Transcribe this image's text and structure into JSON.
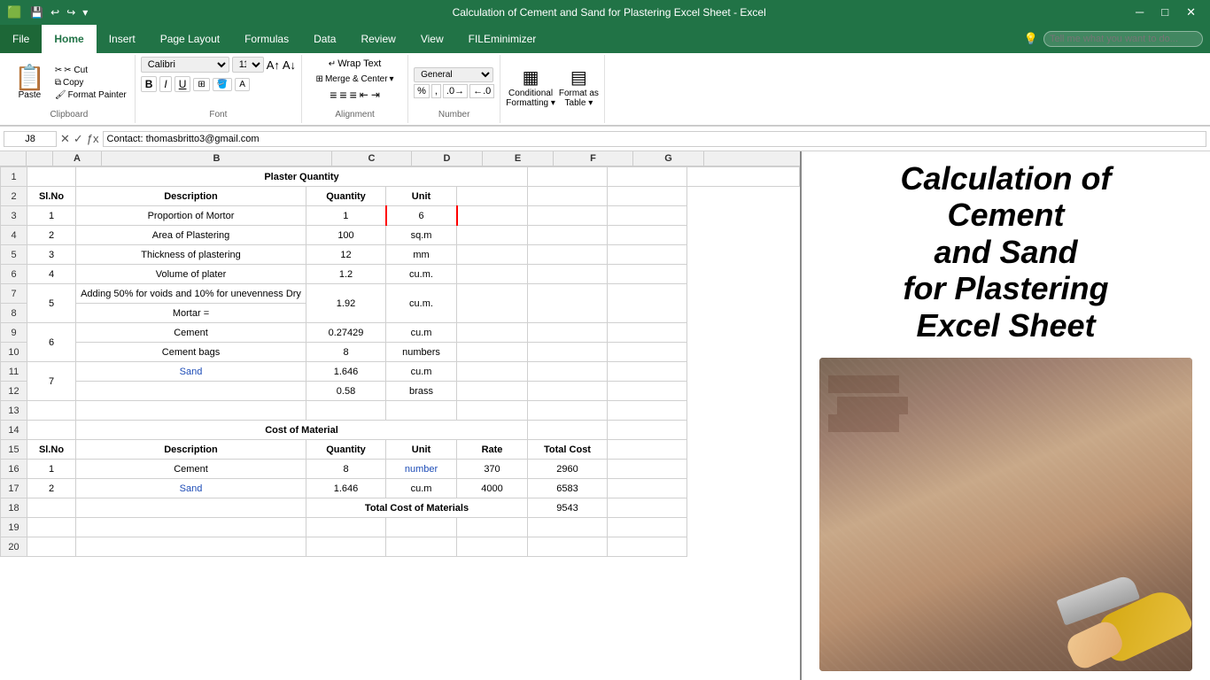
{
  "titleBar": {
    "title": "Calculation of Cement and Sand for Plastering Excel Sheet - Excel",
    "saveIcon": "💾",
    "undoIcon": "↩",
    "redoIcon": "↪"
  },
  "ribbon": {
    "tabs": [
      "File",
      "Home",
      "Insert",
      "Page Layout",
      "Formulas",
      "Data",
      "Review",
      "View",
      "FILEminimizer"
    ],
    "activeTab": "Home",
    "searchPlaceholder": "Tell me what you want to do...",
    "groups": {
      "clipboard": {
        "label": "Clipboard",
        "paste": "Paste",
        "cut": "✂ Cut",
        "copy": "Copy",
        "formatPainter": "Format Painter"
      },
      "font": {
        "label": "Font",
        "fontName": "Calibri",
        "fontSize": "11"
      },
      "alignment": {
        "label": "Alignment",
        "wrapText": "Wrap Text",
        "mergeCenter": "Merge & Center"
      },
      "number": {
        "label": "Number"
      }
    }
  },
  "formulaBar": {
    "cellRef": "J8",
    "formula": "Contact: thomasbritto3@gmail.com"
  },
  "columns": [
    "A",
    "B",
    "C",
    "D",
    "E",
    "F",
    "G"
  ],
  "rows": [
    {
      "num": 1,
      "cells": [
        "",
        "Plaster Quantity",
        "",
        "",
        "",
        "",
        ""
      ],
      "special": "merged-header-row1"
    },
    {
      "num": 2,
      "cells": [
        "Sl.No",
        "Description",
        "Quantity",
        "Unit",
        "",
        "",
        ""
      ],
      "special": "header-row"
    },
    {
      "num": 3,
      "cells": [
        "1",
        "Proportion of Mortor",
        "1",
        "6",
        "",
        "",
        ""
      ],
      "special": "data-row"
    },
    {
      "num": 4,
      "cells": [
        "2",
        "Area of Plastering",
        "100",
        "sq.m",
        "",
        "",
        ""
      ],
      "special": "data-row"
    },
    {
      "num": 5,
      "cells": [
        "3",
        "Thickness of plastering",
        "12",
        "mm",
        "",
        "",
        ""
      ],
      "special": "data-row"
    },
    {
      "num": 6,
      "cells": [
        "4",
        "Volume of plater",
        "1.2",
        "cu.m.",
        "",
        "",
        ""
      ],
      "special": "data-row"
    },
    {
      "num": 7,
      "cells": [
        "5",
        "Adding 50% for voids and 10% for unevenness Dry",
        "1.92",
        "cu.m.",
        "",
        "",
        ""
      ],
      "special": "data-row-merged"
    },
    {
      "num": 8,
      "cells": [
        "",
        "Mortar =",
        "",
        "",
        "",
        "",
        ""
      ],
      "special": "data-row-cont"
    },
    {
      "num": 9,
      "cells": [
        "6",
        "Cement",
        "0.27429",
        "cu.m",
        "",
        "",
        ""
      ],
      "special": "data-row-merged6"
    },
    {
      "num": 10,
      "cells": [
        "",
        "Cement bags",
        "8",
        "numbers",
        "",
        "",
        ""
      ],
      "special": "data-row-cont"
    },
    {
      "num": 11,
      "cells": [
        "7",
        "Sand",
        "1.646",
        "cu.m",
        "",
        "",
        ""
      ],
      "special": "data-row-merged7"
    },
    {
      "num": 12,
      "cells": [
        "",
        "",
        "0.58",
        "brass",
        "",
        "",
        ""
      ],
      "special": "data-row-cont"
    },
    {
      "num": 13,
      "cells": [
        "",
        "",
        "",
        "",
        "",
        "",
        ""
      ],
      "special": "empty-row"
    },
    {
      "num": 14,
      "cells": [
        "",
        "Cost of Material",
        "",
        "",
        "",
        "",
        ""
      ],
      "special": "merged-header-row14"
    },
    {
      "num": 15,
      "cells": [
        "Sl.No",
        "Description",
        "Quantity",
        "Unit",
        "Rate",
        "Total Cost",
        ""
      ],
      "special": "header-row2"
    },
    {
      "num": 16,
      "cells": [
        "1",
        "Cement",
        "8",
        "number",
        "370",
        "2960",
        ""
      ],
      "special": "data-row2"
    },
    {
      "num": 17,
      "cells": [
        "2",
        "Sand",
        "1.646",
        "cu.m",
        "4000",
        "6583",
        ""
      ],
      "special": "data-row2-blue"
    },
    {
      "num": 18,
      "cells": [
        "",
        "",
        "Total Cost of Materials",
        "",
        "",
        "9543",
        ""
      ],
      "special": "total-row"
    },
    {
      "num": 19,
      "cells": [
        "",
        "",
        "",
        "",
        "",
        "",
        ""
      ],
      "special": "empty-row"
    },
    {
      "num": 20,
      "cells": [
        "",
        "",
        "",
        "",
        "",
        "",
        ""
      ],
      "special": "empty-row"
    }
  ],
  "rightPanel": {
    "title": "Calculation of Cement and Sand for Plastering Excel Sheet"
  }
}
